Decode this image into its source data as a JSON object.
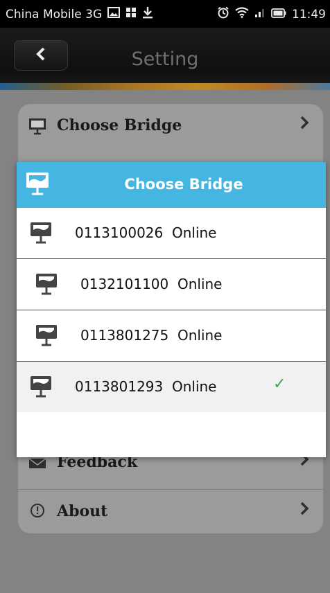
{
  "status_bar": {
    "carrier": "China Mobile 3G",
    "time": "11:49"
  },
  "header": {
    "title": "Setting"
  },
  "settings": {
    "items": [
      {
        "label": "Choose Bridge",
        "icon": "monitor-icon"
      },
      {
        "label": "Feedback",
        "icon": "envelope-icon"
      },
      {
        "label": "About",
        "icon": "info-icon"
      }
    ]
  },
  "dialog": {
    "title": "Choose Bridge",
    "bridges": [
      {
        "id": "0113100026",
        "status": "Online",
        "selected": false
      },
      {
        "id": "0132101100",
        "status": "Online",
        "selected": false
      },
      {
        "id": "0113801275",
        "status": "Online",
        "selected": false
      },
      {
        "id": "0113801293",
        "status": "Online",
        "selected": true
      }
    ],
    "check_glyph": "✓"
  },
  "colors": {
    "accent": "#45b5e2",
    "check": "#3aa84a"
  }
}
